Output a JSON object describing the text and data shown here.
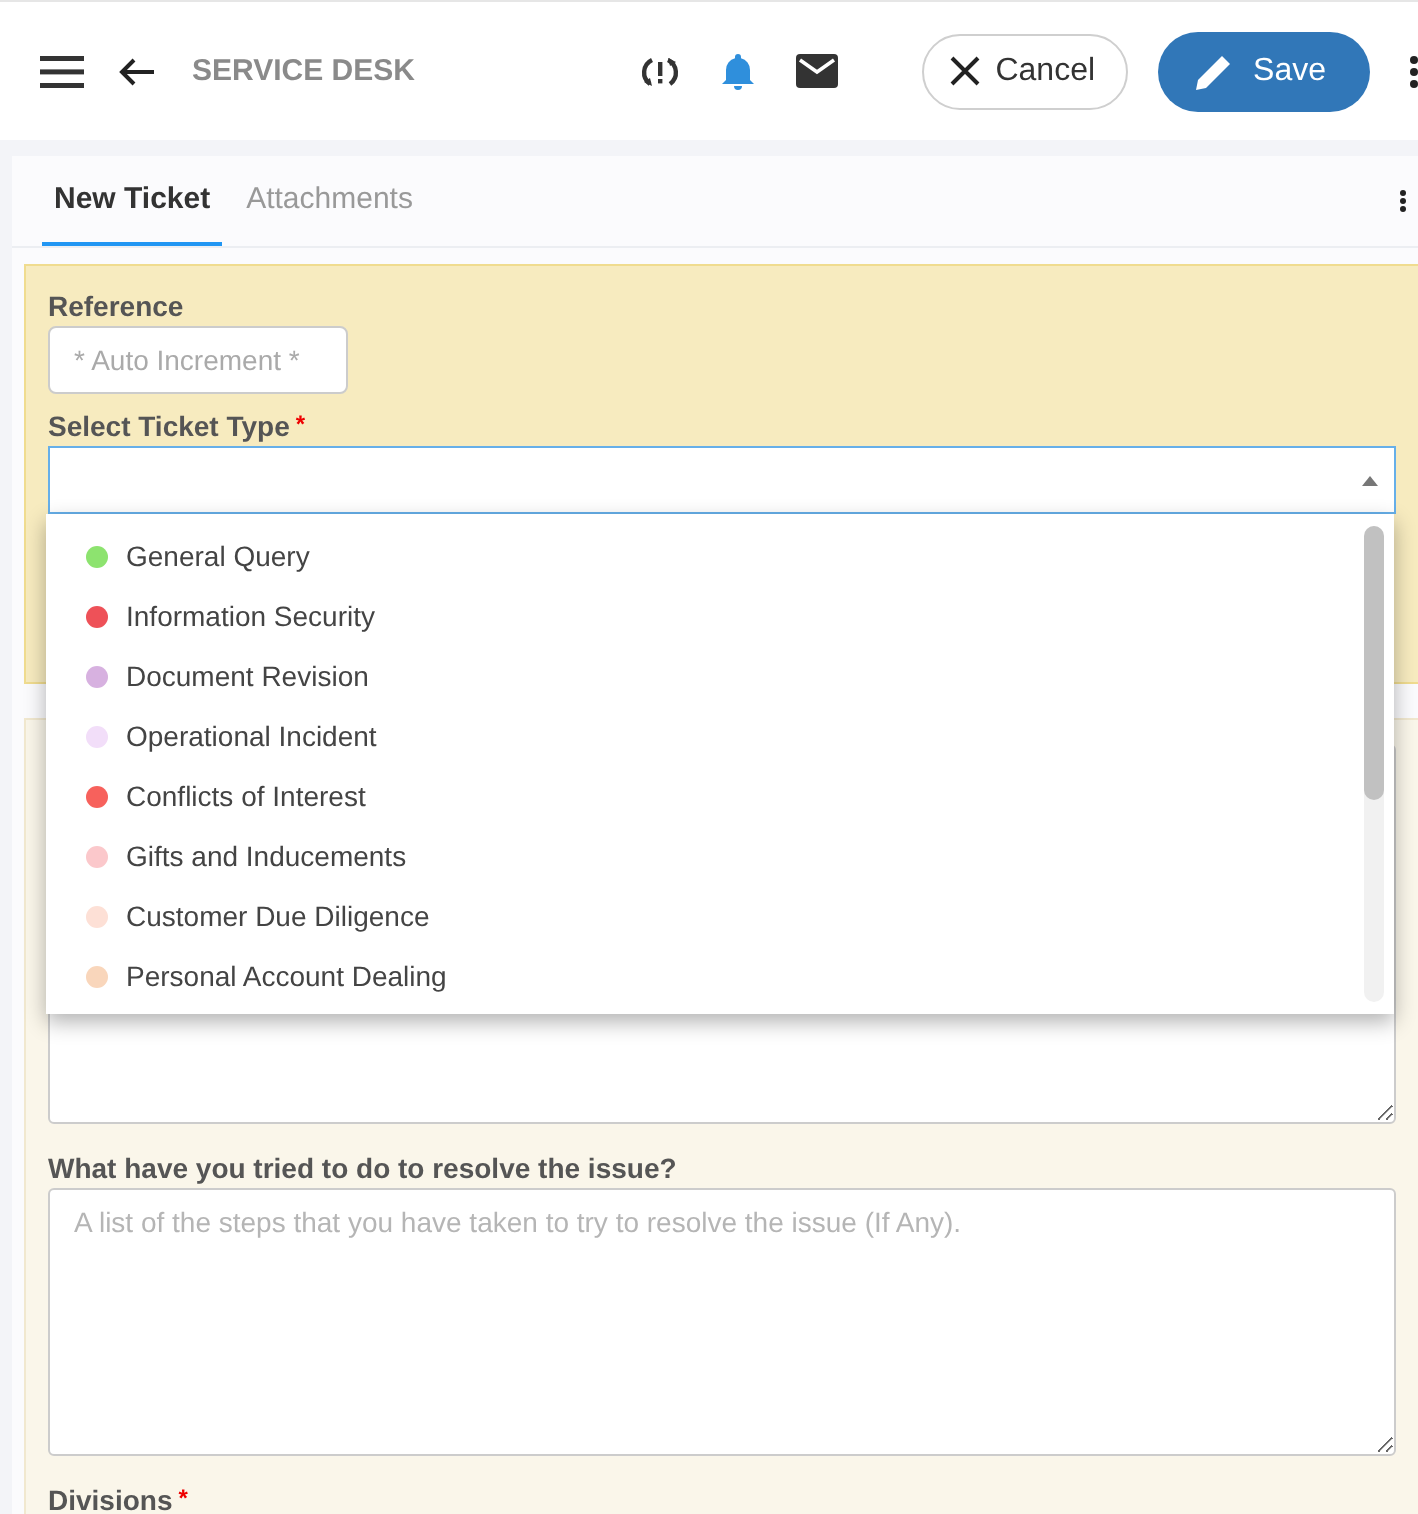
{
  "header": {
    "title": "SERVICE DESK",
    "cancel": "Cancel",
    "save": "Save"
  },
  "tabs": [
    {
      "label": "New Ticket",
      "selected": true
    },
    {
      "label": "Attachments",
      "selected": false
    }
  ],
  "reference": {
    "label": "Reference",
    "placeholder": "* Auto Increment *"
  },
  "ticket_type": {
    "label": "Select Ticket Type",
    "required_mark": "*",
    "options": [
      {
        "label": "General Query",
        "color": "#8de36f"
      },
      {
        "label": "Information Security",
        "color": "#ee5158"
      },
      {
        "label": "Document Revision",
        "color": "#d7b1e0"
      },
      {
        "label": "Operational Incident",
        "color": "#f2def9"
      },
      {
        "label": "Conflicts of Interest",
        "color": "#f7615c"
      },
      {
        "label": "Gifts and Inducements",
        "color": "#fbc8cb"
      },
      {
        "label": "Customer Due Diligence",
        "color": "#fde0d6"
      },
      {
        "label": "Personal Account Dealing",
        "color": "#f9d6bb"
      }
    ]
  },
  "resolve": {
    "label": "What have you tried to do to resolve the issue?",
    "placeholder": "A list of the steps that you have taken to try to resolve the issue (If Any)."
  },
  "divisions": {
    "label": "Divisions",
    "required_mark": "*"
  }
}
